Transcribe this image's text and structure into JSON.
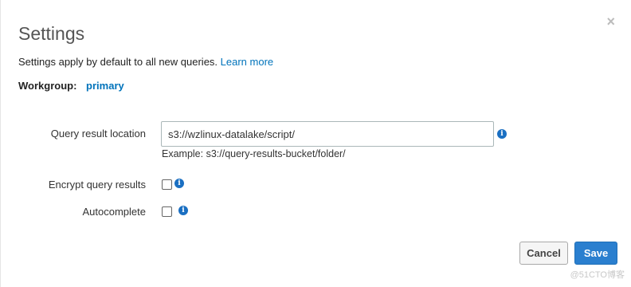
{
  "dialog": {
    "title": "Settings",
    "close_glyph": "×",
    "subtitle": "Settings apply by default to all new queries. ",
    "learn_more": "Learn more",
    "workgroup_label": "Workgroup:",
    "workgroup_value": "primary"
  },
  "form": {
    "query_result_location": {
      "label": "Query result location",
      "value": "s3://wzlinux-datalake/script/",
      "hint": "Example: s3://query-results-bucket/folder/"
    },
    "encrypt": {
      "label": "Encrypt query results",
      "checked": false
    },
    "autocomplete": {
      "label": "Autocomplete",
      "checked": false
    },
    "info_glyph": "i"
  },
  "buttons": {
    "cancel": "Cancel",
    "save": "Save"
  },
  "watermark": "@51CTO博客",
  "colors": {
    "link": "#0073bb",
    "primary_button": "#2a7fcf",
    "info_icon": "#1a6fc2"
  }
}
